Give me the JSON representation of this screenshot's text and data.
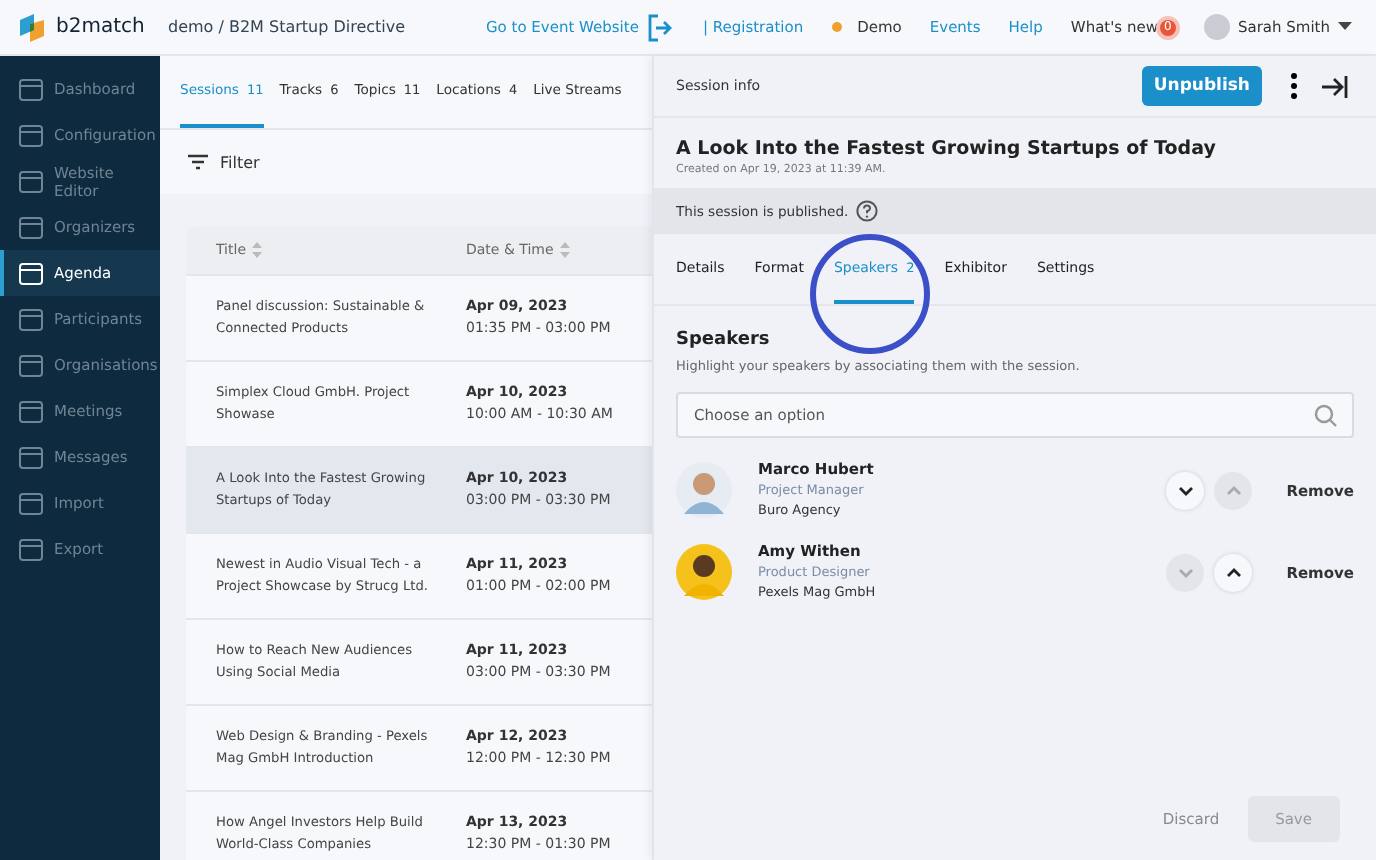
{
  "topbar": {
    "logo": "b2match",
    "breadcrumb": "demo / B2M Startup Directive",
    "links": [
      {
        "label": "Go to Event Website",
        "kind": "link"
      },
      {
        "label": "| Registration",
        "kind": "link"
      },
      {
        "label": "Demo",
        "kind": "status"
      },
      {
        "label": "Events",
        "kind": "link"
      },
      {
        "label": "Help",
        "kind": "link"
      },
      {
        "label": "What's new",
        "kind": "plain"
      }
    ],
    "badge": "0",
    "user": "Sarah Smith"
  },
  "sidebar": {
    "items": [
      {
        "label": "Dashboard",
        "selected": false
      },
      {
        "label": "Configuration",
        "selected": false
      },
      {
        "label": "Website Editor",
        "selected": false
      },
      {
        "label": "Organizers",
        "selected": false
      },
      {
        "label": "Agenda",
        "selected": true
      },
      {
        "label": "Participants",
        "selected": false
      },
      {
        "label": "Organisations",
        "selected": false
      },
      {
        "label": "Meetings",
        "selected": false
      },
      {
        "label": "Messages",
        "selected": false
      },
      {
        "label": "Import",
        "selected": false
      },
      {
        "label": "Export",
        "selected": false
      }
    ]
  },
  "tabs": [
    {
      "label": "Sessions",
      "count": "11",
      "selected": true
    },
    {
      "label": "Tracks",
      "count": "6",
      "selected": false
    },
    {
      "label": "Topics",
      "count": "11",
      "selected": false
    },
    {
      "label": "Locations",
      "count": "4",
      "selected": false
    },
    {
      "label": "Live Streams",
      "selected": false
    }
  ],
  "filter": "Filter",
  "table": {
    "columns": [
      "Title",
      "Date & Time"
    ],
    "rows": [
      {
        "title": "Panel discussion: Sustainable & Connected Products",
        "date": "Apr 09, 2023",
        "time": "01:35 PM - 03:00 PM",
        "selected": false
      },
      {
        "title": "Simplex Cloud GmbH. Project Showase",
        "date": "Apr 10, 2023",
        "time": "10:00 AM - 10:30 AM",
        "selected": false
      },
      {
        "title": "A Look Into the Fastest Growing Startups of Today",
        "date": "Apr 10, 2023",
        "time": "03:00 PM - 03:30 PM",
        "selected": true
      },
      {
        "title": "Newest in Audio Visual Tech - a Project Showcase by Strucg Ltd.",
        "date": "Apr 11, 2023",
        "time": "01:00 PM - 02:00 PM",
        "selected": false
      },
      {
        "title": "How to Reach New Audiences Using Social Media",
        "date": "Apr 11, 2023",
        "time": "03:00 PM - 03:30 PM",
        "selected": false
      },
      {
        "title": "Web Design & Branding - Pexels Mag GmbH Introduction",
        "date": "Apr 12, 2023",
        "time": "12:00 PM - 12:30 PM",
        "selected": false
      },
      {
        "title": "How Angel Investors Help Build World-Class Companies",
        "date": "Apr 13, 2023",
        "time": "12:30 PM - 01:30 PM",
        "selected": false
      }
    ]
  },
  "panel": {
    "header": "Session info",
    "unpublish": "Unpublish",
    "title": "A Look Into the Fastest Growing Startups of Today",
    "created": "Created on Apr 19, 2023 at 11:39 AM.",
    "notice": "This session is published.",
    "tabs": [
      {
        "label": "Details",
        "selected": false
      },
      {
        "label": "Format",
        "selected": false
      },
      {
        "label": "Speakers",
        "count": "2",
        "selected": true
      },
      {
        "label": "Exhibitor",
        "selected": false
      },
      {
        "label": "Settings",
        "selected": false
      }
    ],
    "heading": "Speakers",
    "hint": "Highlight your speakers by associating them with the session.",
    "search": {
      "placeholder": "Choose an option"
    },
    "speakers": [
      {
        "name": "Marco Hubert",
        "role": "Project Manager",
        "company": "Buro Agency",
        "down_disabled": false,
        "up_disabled": true,
        "remove": "Remove"
      },
      {
        "name": "Amy Withen",
        "role": "Product Designer",
        "company": "Pexels Mag GmbH",
        "down_disabled": true,
        "up_disabled": false,
        "remove": "Remove"
      }
    ],
    "discard": "Discard",
    "save": {
      "label": "Save",
      "disabled": true
    }
  }
}
